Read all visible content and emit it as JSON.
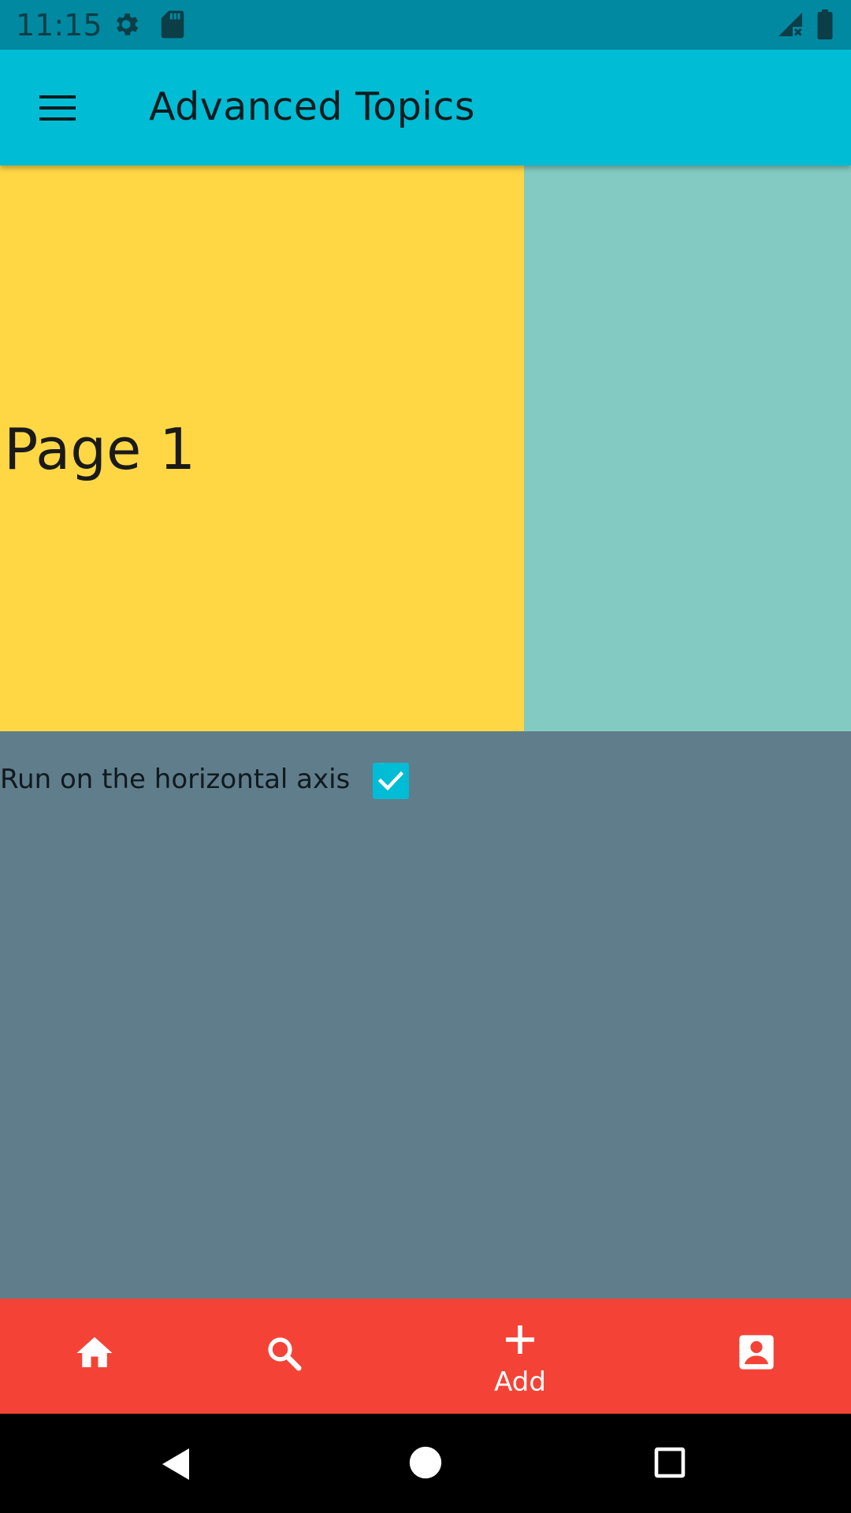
{
  "status_bar": {
    "time": "11:15",
    "icons": [
      "gear-icon",
      "sd-card-icon",
      "no-signal-icon",
      "battery-icon"
    ]
  },
  "app_bar": {
    "title": "Advanced Topics",
    "menu_icon": "menu-icon"
  },
  "pager": {
    "pages": [
      {
        "label": "Page 1",
        "color": "#ffd745"
      },
      {
        "label": "",
        "color": "#83cbc2"
      }
    ]
  },
  "controls": {
    "axis_label": "Run on the horizontal axis",
    "axis_checked": true
  },
  "bottom_nav": {
    "items": [
      {
        "icon": "home-icon",
        "label": ""
      },
      {
        "icon": "search-icon",
        "label": ""
      },
      {
        "icon": "add-icon",
        "label": "Add"
      },
      {
        "icon": "contact-icon",
        "label": ""
      }
    ]
  },
  "colors": {
    "status_bar": "#0089a0",
    "app_bar": "#00bcd4",
    "background": "#607d8b",
    "bottom_nav": "#f44336",
    "system_nav": "#000000"
  }
}
